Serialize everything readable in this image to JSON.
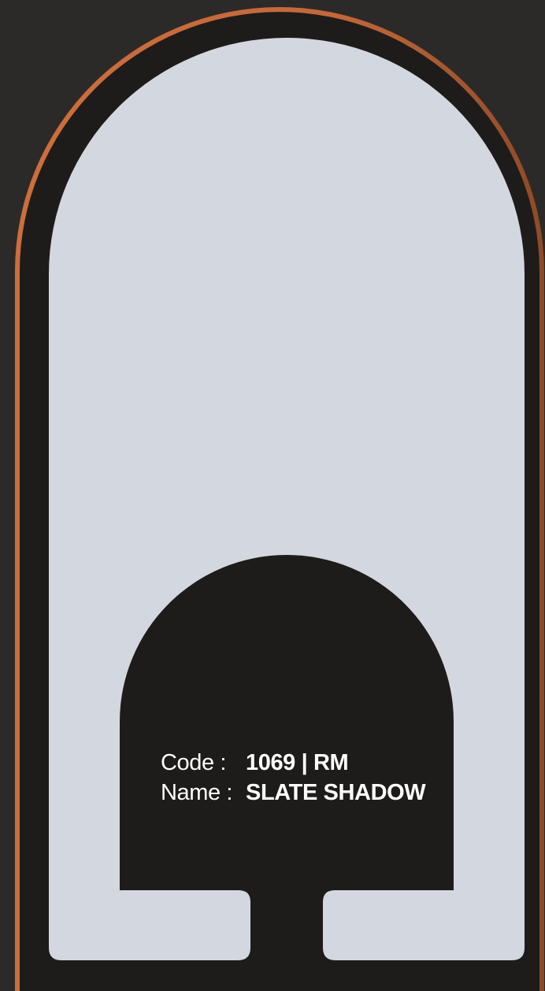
{
  "swatch": {
    "code_label": "Code  :",
    "code_value": "1069 | RM",
    "name_label": "Name :",
    "name_value": "SLATE SHADOW",
    "swatch_color": "#d3d7df"
  },
  "colors": {
    "background": "#2c2a29",
    "frame": "#1e1c1a",
    "border_accent": "#c7693a",
    "text": "#ffffff"
  }
}
